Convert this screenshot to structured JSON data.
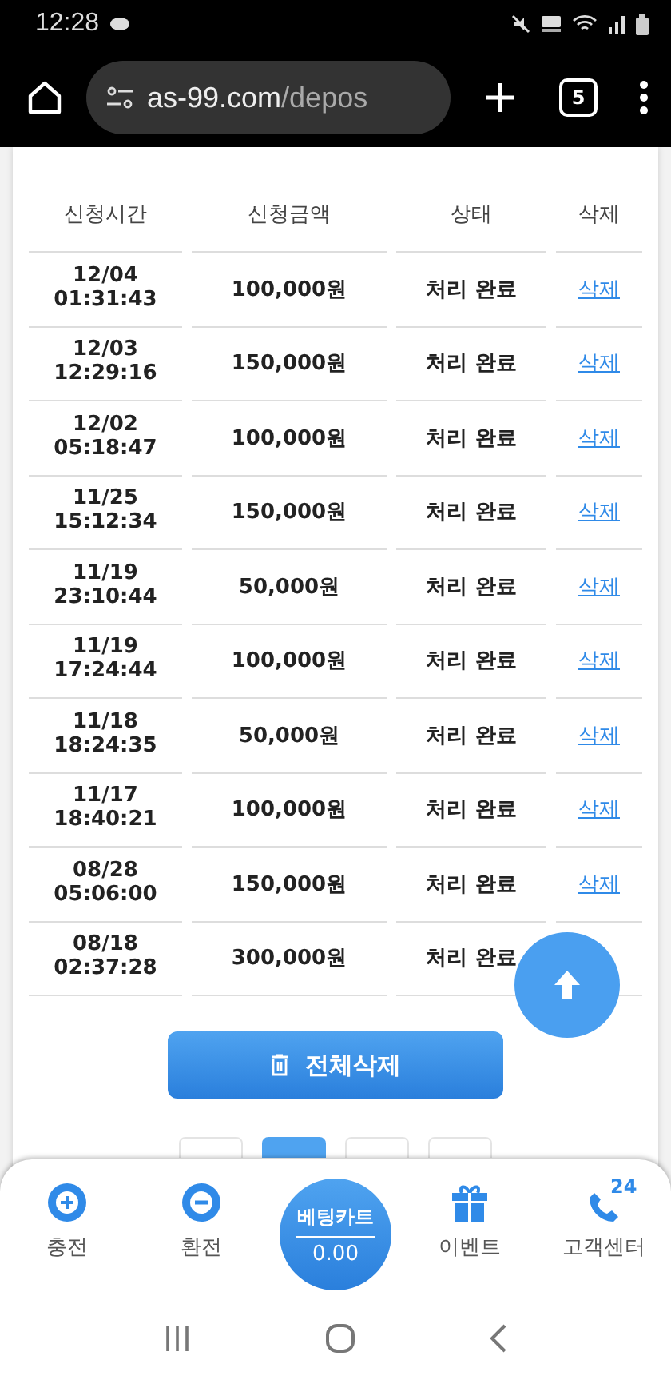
{
  "status_bar": {
    "time": "12:28"
  },
  "browser": {
    "url_host": "as-99.com",
    "url_path": "/depos",
    "tab_count": "5"
  },
  "table": {
    "columns": [
      "신청시간",
      "신청금액",
      "상태",
      "삭제"
    ],
    "rows": [
      {
        "date": "12/04",
        "time": "01:31:43",
        "amount": "100,000원",
        "status": "처리 완료",
        "action": "삭제"
      },
      {
        "date": "12/03",
        "time": "12:29:16",
        "amount": "150,000원",
        "status": "처리 완료",
        "action": "삭제"
      },
      {
        "date": "12/02",
        "time": "05:18:47",
        "amount": "100,000원",
        "status": "처리 완료",
        "action": "삭제"
      },
      {
        "date": "11/25",
        "time": "15:12:34",
        "amount": "150,000원",
        "status": "처리 완료",
        "action": "삭제"
      },
      {
        "date": "11/19",
        "time": "23:10:44",
        "amount": "50,000원",
        "status": "처리 완료",
        "action": "삭제"
      },
      {
        "date": "11/19",
        "time": "17:24:44",
        "amount": "100,000원",
        "status": "처리 완료",
        "action": "삭제"
      },
      {
        "date": "11/18",
        "time": "18:24:35",
        "amount": "50,000원",
        "status": "처리 완료",
        "action": "삭제"
      },
      {
        "date": "11/17",
        "time": "18:40:21",
        "amount": "100,000원",
        "status": "처리 완료",
        "action": "삭제"
      },
      {
        "date": "08/28",
        "time": "05:06:00",
        "amount": "150,000원",
        "status": "처리 완료",
        "action": "삭제"
      },
      {
        "date": "08/18",
        "time": "02:37:28",
        "amount": "300,000원",
        "status": "처리 완료"
      }
    ]
  },
  "delete_all_button": "전체삭제",
  "pagination": [
    {
      "selected": false
    },
    {
      "selected": true
    },
    {
      "selected": false
    },
    {
      "selected": false
    }
  ],
  "bottom_nav": [
    {
      "kind": "charge",
      "label": "충전"
    },
    {
      "kind": "exchange",
      "label": "환전"
    },
    {
      "kind": "cart",
      "label": "베팅카트",
      "value": "0.00"
    },
    {
      "kind": "event",
      "label": "이벤트"
    },
    {
      "kind": "support",
      "label": "고객센터",
      "badge": "24"
    }
  ]
}
